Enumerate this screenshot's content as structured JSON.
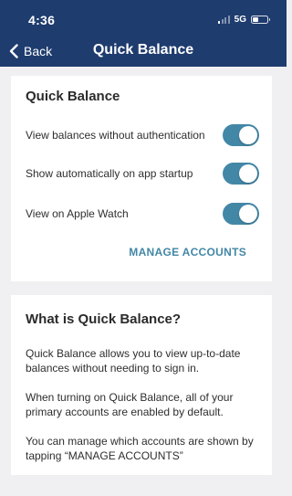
{
  "status_bar": {
    "time": "4:36",
    "network": "5G",
    "signal_bars_active": 1,
    "signal_bars_total": 4,
    "battery_level": 0.4
  },
  "nav": {
    "back_label": "Back",
    "title": "Quick Balance"
  },
  "settings_card": {
    "title": "Quick Balance",
    "settings": [
      {
        "label": "View balances without authentication",
        "enabled": true
      },
      {
        "label": "Show automatically on app startup",
        "enabled": true
      },
      {
        "label": "View on Apple Watch",
        "enabled": true
      }
    ],
    "manage_link": "MANAGE ACCOUNTS"
  },
  "info_card": {
    "title": "What is Quick Balance?",
    "paragraphs": [
      "Quick Balance allows you to view up-to-date balances without needing to sign in.",
      "When turning on Quick Balance, all of your primary accounts are enabled by default.",
      "You can manage which accounts are shown by tapping “MANAGE ACCOUNTS”"
    ]
  },
  "colors": {
    "header_background": "#1e3c6e",
    "page_background": "#f0f0f2",
    "accent": "#4387a7",
    "card_background": "#ffffff"
  },
  "icons": {
    "back": "chevron-left-icon",
    "signal": "cellular-signal-icon",
    "battery": "battery-icon"
  }
}
